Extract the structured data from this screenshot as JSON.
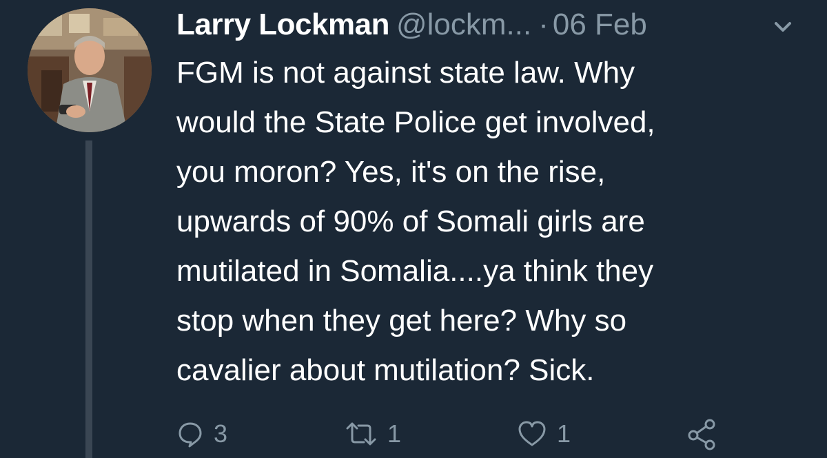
{
  "tweet": {
    "author_name": "Larry Lockman",
    "handle": "@lockm...",
    "separator": "·",
    "date": "06 Feb",
    "body_lines": [
      "FGM is not against state law. Why",
      "would the State Police get involved,",
      "you moron? Yes, it's on the rise,",
      "upwards of 90% of Somali girls are",
      "mutilated in Somalia....ya think they",
      "stop when they get here? Why so",
      "cavalier about mutilation? Sick."
    ],
    "actions": {
      "reply_count": "3",
      "retweet_count": "1",
      "like_count": "1"
    },
    "icons": {
      "avatar": "avatar",
      "more": "chevron-down-icon",
      "reply": "reply-icon",
      "retweet": "retweet-icon",
      "like": "heart-icon",
      "share": "share-icon"
    }
  },
  "colors": {
    "background": "#1b2836",
    "primary_text": "#ffffff",
    "secondary_text": "#8899a6",
    "thread_line": "#3a4653"
  }
}
